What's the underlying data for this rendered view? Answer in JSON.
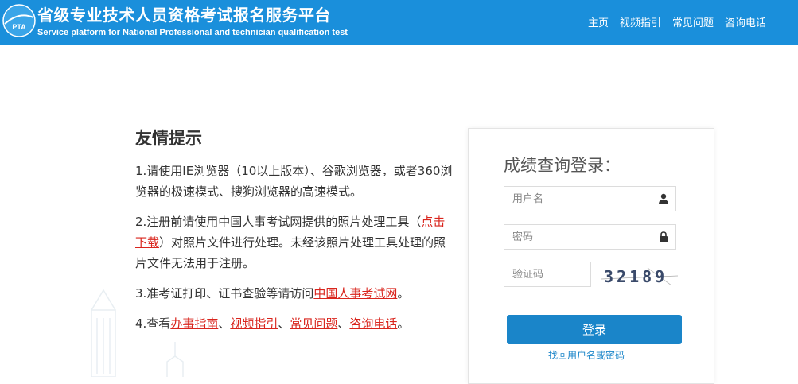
{
  "header": {
    "title": "省级专业技术人员资格考试报名服务平台",
    "subtitle": "Service platform for National Professional and technician qualification test",
    "logo_text": "PTA",
    "nav": [
      "主页",
      "视频指引",
      "常见问题",
      "咨询电话"
    ]
  },
  "tips": {
    "heading": "友情提示",
    "item1": "1.请使用IE浏览器（10以上版本）、谷歌浏览器，或者360浏览器的极速模式、搜狗浏览器的高速模式。",
    "item2_a": "2.注册前请使用中国人事考试网提供的照片处理工具（",
    "item2_link": "点击下载",
    "item2_b": "）对照片文件进行处理。未经该照片处理工具处理的照片文件无法用于注册。",
    "item3_a": "3.准考证打印、证书查验等请访问",
    "item3_link": "中国人事考试网",
    "item3_b": "。",
    "item4_a": "4.查看",
    "item4_links": [
      "办事指南",
      "视频指引",
      "常见问题",
      "咨询电话"
    ],
    "item4_sep": "、",
    "item4_end": "。"
  },
  "login": {
    "title": "成绩查询登录：",
    "username_placeholder": "用户名",
    "password_placeholder": "密码",
    "captcha_placeholder": "验证码",
    "captcha_text": "32189",
    "submit_label": "登录",
    "forgot_label": "找回用户名或密码"
  },
  "colors": {
    "header_bg": "#1a8fdb",
    "button_bg": "#1a85c9",
    "link_red": "#d9251d"
  }
}
